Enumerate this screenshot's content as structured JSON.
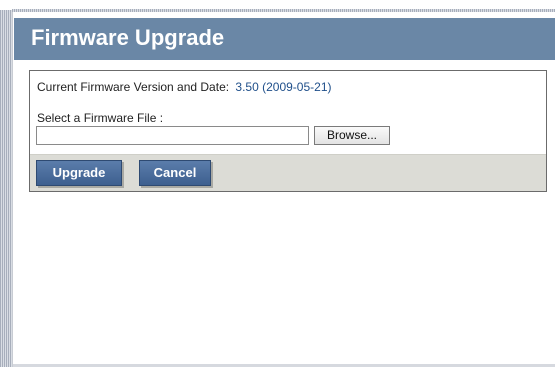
{
  "page": {
    "title": "Firmware Upgrade"
  },
  "firmware": {
    "current_label": "Current Firmware Version and Date:",
    "current_value": "3.50 (2009-05-21)",
    "select_label": "Select a Firmware File :",
    "file_value": "",
    "browse_label": "Browse..."
  },
  "actions": {
    "upgrade_label": "Upgrade",
    "cancel_label": "Cancel"
  },
  "colors": {
    "title_bar": "#6a87a6",
    "button_blue": "#3d5f8f",
    "action_bar": "#dcdcd6",
    "version_value": "#1f4f8a"
  }
}
